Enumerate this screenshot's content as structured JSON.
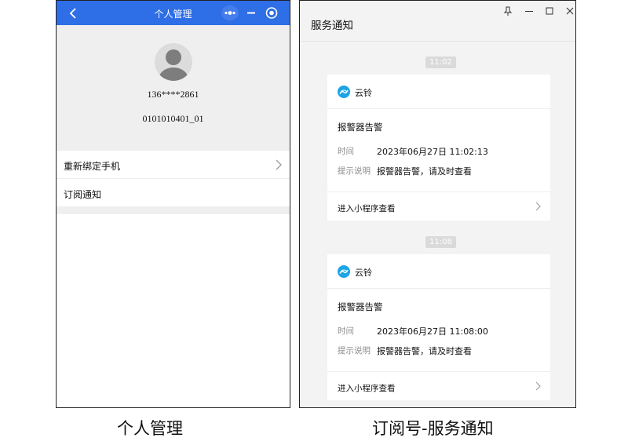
{
  "colors": {
    "header_blue": "#2e6ee6",
    "gray_bg": "#efefef",
    "card_bg": "#ffffff",
    "muted_text": "#8c8c8c"
  },
  "left": {
    "header": {
      "title": "个人管理",
      "icons": [
        "back-arrow-icon",
        "more-dots-icon",
        "minimize-icon",
        "close-circle-icon"
      ]
    },
    "profile": {
      "avatar": "user-avatar-icon",
      "phone": "136****2861",
      "account": "0101010401_01"
    },
    "menu": [
      {
        "label": "重新绑定手机",
        "chevron": "chevron-right-icon"
      },
      {
        "label": "订阅通知"
      }
    ]
  },
  "right": {
    "window": {
      "title": "服务通知",
      "controls": [
        "pin-icon",
        "minimize-icon",
        "maximize-icon",
        "close-icon"
      ]
    },
    "messages": [
      {
        "time_chip": "11:02",
        "app_name": "云铃",
        "title": "报警器告警",
        "time_label": "时间",
        "time_value": "2023年06月27日 11:02:13",
        "desc_label": "提示说明",
        "desc_value": "报警器告警，请及时查看",
        "action": "进入小程序查看"
      },
      {
        "time_chip": "11:08",
        "app_name": "云铃",
        "title": "报警器告警",
        "time_label": "时间",
        "time_value": "2023年06月27日 11:08:00",
        "desc_label": "提示说明",
        "desc_value": "报警器告警，请及时查看",
        "action": "进入小程序查看"
      }
    ]
  },
  "captions": {
    "left": "个人管理",
    "right": "订阅号-服务通知"
  }
}
